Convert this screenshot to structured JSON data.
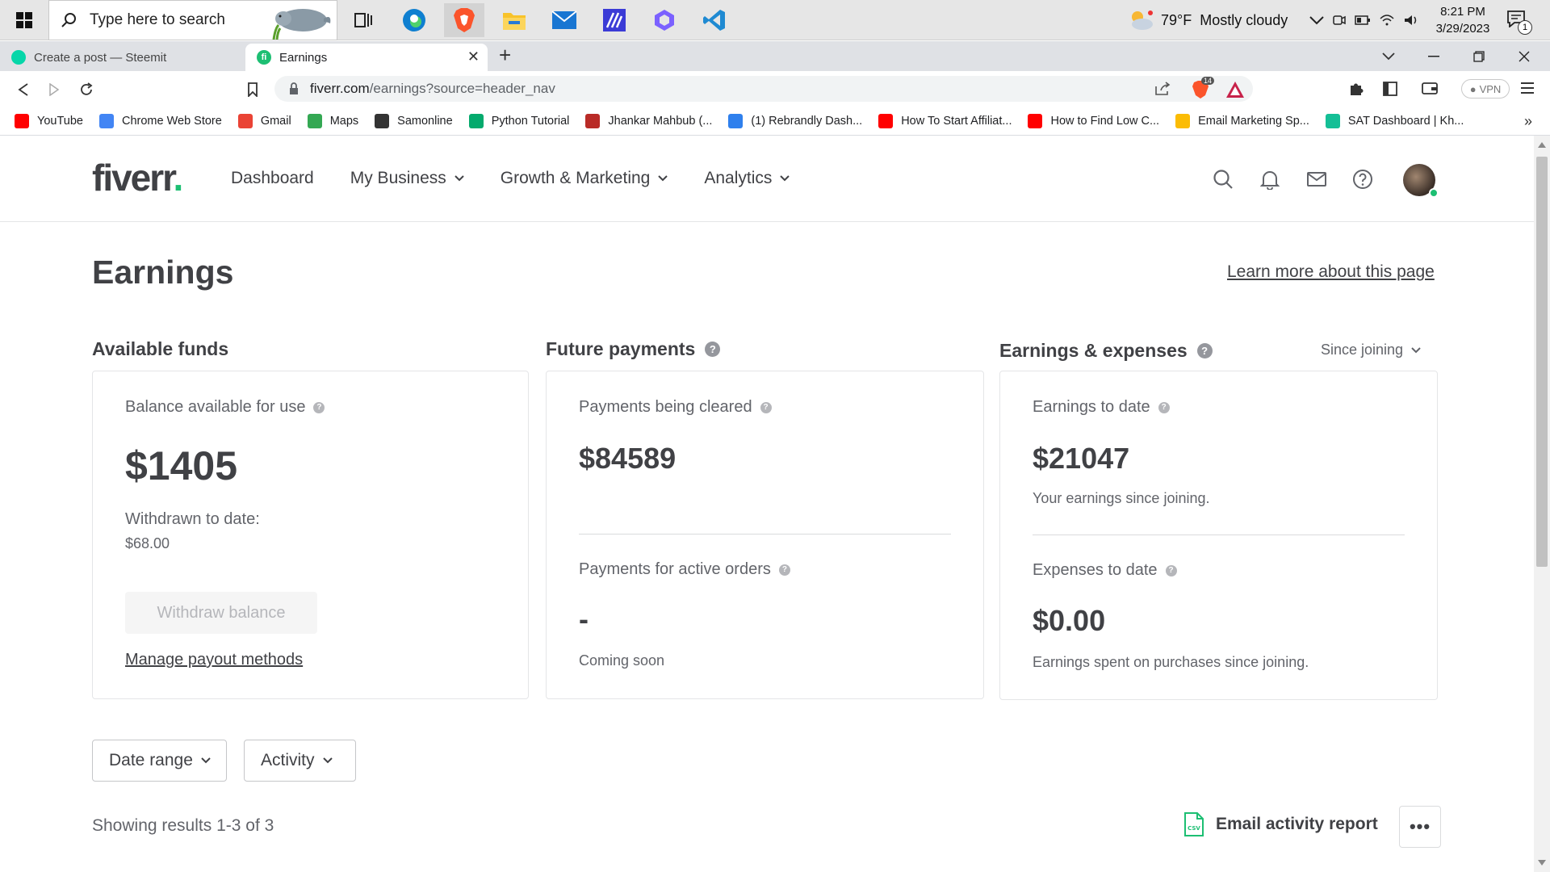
{
  "taskbar": {
    "search_placeholder": "Type here to search",
    "weather": {
      "temp": "79°F",
      "condition": "Mostly cloudy"
    },
    "clock": {
      "time": "8:21 PM",
      "date": "3/29/2023"
    },
    "notification_count": "1",
    "pinned_apps": [
      "task-view",
      "edge",
      "brave",
      "file-explorer",
      "mail",
      "app",
      "copilot",
      "vscode"
    ]
  },
  "browser": {
    "tabs": [
      {
        "title": "Create a post — Steemit",
        "active": false
      },
      {
        "title": "Earnings",
        "active": true
      }
    ],
    "url_main": "fiverr.com",
    "url_path": "/earnings?source=header_nav",
    "brave_shield_count": "14",
    "vpn_label": "VPN",
    "bookmarks": [
      {
        "label": "YouTube",
        "color": "#ff0000"
      },
      {
        "label": "Chrome Web Store",
        "color": "#4285f4"
      },
      {
        "label": "Gmail",
        "color": "#ea4335"
      },
      {
        "label": "Maps",
        "color": "#34a853"
      },
      {
        "label": "Samonline",
        "color": "#333333"
      },
      {
        "label": "Python Tutorial",
        "color": "#04aa6d"
      },
      {
        "label": "Jhankar Mahbub (...",
        "color": "#b92b27"
      },
      {
        "label": "(1) Rebrandly Dash...",
        "color": "#2f80ed"
      },
      {
        "label": "How To Start Affiliat...",
        "color": "#ff0000"
      },
      {
        "label": "How to Find Low C...",
        "color": "#ff0000"
      },
      {
        "label": "Email Marketing Sp...",
        "color": "#fbbc04"
      },
      {
        "label": "SAT Dashboard | Kh...",
        "color": "#14bf96"
      }
    ]
  },
  "header": {
    "logo_text": "fiverr",
    "logo_dot": ".",
    "nav": [
      {
        "label": "Dashboard",
        "dropdown": false
      },
      {
        "label": "My Business",
        "dropdown": true
      },
      {
        "label": "Growth & Marketing",
        "dropdown": true
      },
      {
        "label": "Analytics",
        "dropdown": true
      }
    ]
  },
  "page": {
    "title": "Earnings",
    "learn_more": "Learn more about this page"
  },
  "available_funds": {
    "title": "Available funds",
    "balance_label": "Balance available for use",
    "balance": "$1405",
    "withdrawn_label": "Withdrawn to date:",
    "withdrawn_value": "$68.00",
    "withdraw_button": "Withdraw balance",
    "manage_link": "Manage payout methods"
  },
  "future_payments": {
    "title": "Future payments",
    "cleared_label": "Payments being cleared",
    "cleared_value": "$84589",
    "active_label": "Payments for active orders",
    "active_value": "-",
    "active_note": "Coming soon"
  },
  "earnings_expenses": {
    "title": "Earnings & expenses",
    "period": "Since joining",
    "earnings_label": "Earnings to date",
    "earnings_value": "$21047",
    "earnings_note": "Your earnings since joining.",
    "expenses_label": "Expenses to date",
    "expenses_value": "$0.00",
    "expenses_note": "Earnings spent on purchases since joining."
  },
  "filters": {
    "date_range": "Date range",
    "activity": "Activity"
  },
  "results": {
    "summary": "Showing results 1-3 of 3",
    "email_report": "Email activity report",
    "more": "•••"
  },
  "colors": {
    "brand_green": "#1dbf73",
    "text_dark": "#404145",
    "text_muted": "#62646a"
  }
}
